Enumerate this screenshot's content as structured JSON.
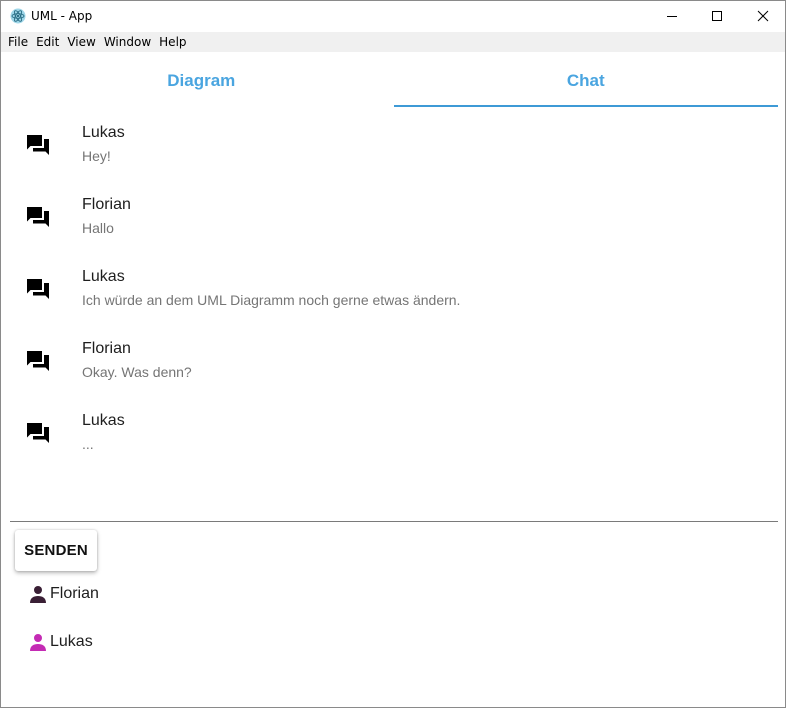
{
  "window": {
    "title": "UML - App"
  },
  "menu": [
    "File",
    "Edit",
    "View",
    "Window",
    "Help"
  ],
  "tabs": [
    {
      "label": "Diagram",
      "active": false
    },
    {
      "label": "Chat",
      "active": true
    }
  ],
  "messages": [
    {
      "sender": "Lukas",
      "text": "Hey!"
    },
    {
      "sender": "Florian",
      "text": "Hallo"
    },
    {
      "sender": "Lukas",
      "text": "Ich würde an dem UML Diagramm noch gerne etwas ändern."
    },
    {
      "sender": "Florian",
      "text": "Okay. Was denn?"
    },
    {
      "sender": "Lukas",
      "text": "..."
    }
  ],
  "send_button": {
    "label": "SENDEN"
  },
  "users": [
    {
      "name": "Florian",
      "color": "#3a1f35"
    },
    {
      "name": "Lukas",
      "color": "#c42bb4"
    }
  ],
  "colors": {
    "tab_text": "#4aa5e0",
    "tab_indicator": "#3e9ad6",
    "message_icon": "#000000"
  },
  "icons": {
    "message": "forum-icon",
    "user": "person-icon",
    "app": "electron-app-icon"
  }
}
